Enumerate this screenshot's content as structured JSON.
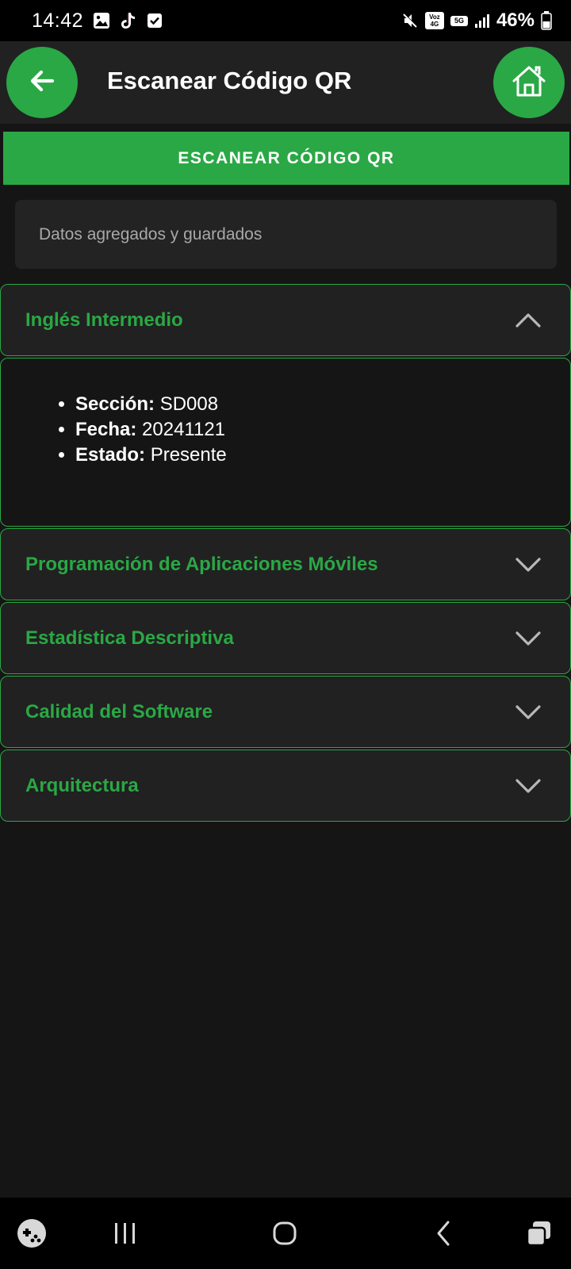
{
  "status_bar": {
    "time": "14:42",
    "battery": "46%",
    "network_badges": [
      "Voz 4G",
      "5G"
    ],
    "left_icons": [
      "gallery-icon",
      "tiktok-icon",
      "checkbox-icon"
    ],
    "right_icons": [
      "mute-icon",
      "signal-icon",
      "battery-icon"
    ]
  },
  "app_bar": {
    "title": "Escanear Código QR",
    "back_icon": "arrow-left-icon",
    "home_icon": "home-icon"
  },
  "scan_button": {
    "label": "ESCANEAR CÓDIGO QR"
  },
  "message": {
    "text": "Datos agregados y guardados"
  },
  "courses": [
    {
      "title": "Inglés Intermedio",
      "expanded": true,
      "details": [
        {
          "label": "Sección:",
          "value": "SD008"
        },
        {
          "label": "Fecha:",
          "value": "20241121"
        },
        {
          "label": "Estado:",
          "value": "Presente"
        }
      ]
    },
    {
      "title": "Programación de Aplicaciones Móviles",
      "expanded": false
    },
    {
      "title": "Estadística Descriptiva",
      "expanded": false
    },
    {
      "title": "Calidad del Software",
      "expanded": false
    },
    {
      "title": "Arquitectura",
      "expanded": false
    }
  ],
  "nav_bar": {
    "items": [
      "game-launcher-icon",
      "recent-apps-icon",
      "home-circle-icon",
      "back-chevron-icon",
      "multi-window-icon"
    ]
  },
  "colors": {
    "accent": "#2aa845",
    "background": "#151515",
    "surface": "#212121"
  }
}
